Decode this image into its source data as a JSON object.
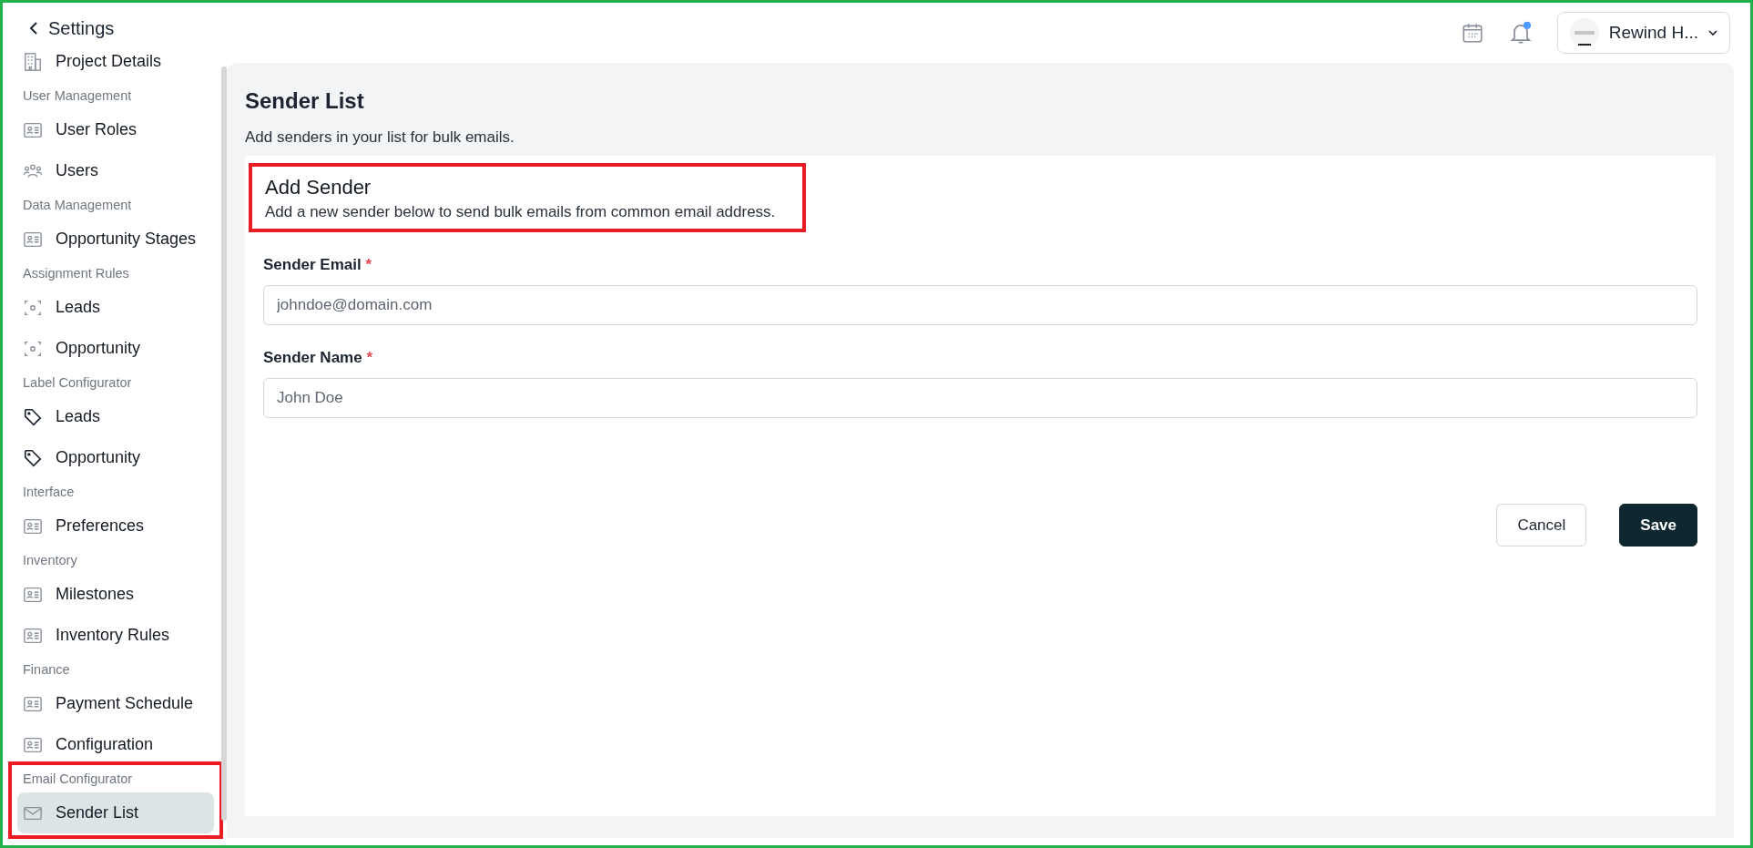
{
  "back": {
    "label": "Settings"
  },
  "sidebar": {
    "items": [
      {
        "label": "Project Details",
        "kind": "building",
        "selected": false
      }
    ],
    "groups": [
      {
        "title": "User Management",
        "highlighted": false,
        "items": [
          {
            "label": "User Roles",
            "kind": "card",
            "selected": false
          },
          {
            "label": "Users",
            "kind": "people",
            "selected": false
          }
        ]
      },
      {
        "title": "Data Management",
        "highlighted": false,
        "items": [
          {
            "label": "Opportunity Stages",
            "kind": "card",
            "selected": false
          }
        ]
      },
      {
        "title": "Assignment Rules",
        "highlighted": false,
        "items": [
          {
            "label": "Leads",
            "kind": "focus",
            "selected": false
          },
          {
            "label": "Opportunity",
            "kind": "focus",
            "selected": false
          }
        ]
      },
      {
        "title": "Label Configurator",
        "highlighted": false,
        "items": [
          {
            "label": "Leads",
            "kind": "tag",
            "selected": false
          },
          {
            "label": "Opportunity",
            "kind": "tag",
            "selected": false
          }
        ]
      },
      {
        "title": "Interface",
        "highlighted": false,
        "items": [
          {
            "label": "Preferences",
            "kind": "card",
            "selected": false
          }
        ]
      },
      {
        "title": "Inventory",
        "highlighted": false,
        "items": [
          {
            "label": "Milestones",
            "kind": "card",
            "selected": false
          },
          {
            "label": "Inventory Rules",
            "kind": "card",
            "selected": false
          }
        ]
      },
      {
        "title": "Finance",
        "highlighted": false,
        "items": [
          {
            "label": "Payment Schedule",
            "kind": "card",
            "selected": false
          },
          {
            "label": "Configuration",
            "kind": "card",
            "selected": false
          }
        ]
      },
      {
        "title": "Email Configurator",
        "highlighted": true,
        "items": [
          {
            "label": "Sender List",
            "kind": "mail",
            "selected": true
          }
        ]
      }
    ]
  },
  "header": {
    "notification_unread": true,
    "account": {
      "label": "Rewind H..."
    }
  },
  "page": {
    "title": "Sender List",
    "subtitle": "Add senders in your list for bulk emails."
  },
  "form": {
    "title": "Add Sender",
    "description": "Add a new sender below to send bulk emails from common email address.",
    "highlighted": true,
    "fields": [
      {
        "label": "Sender Email",
        "required_mark": "*",
        "placeholder": "johndoe@domain.com"
      },
      {
        "label": "Sender Name",
        "required_mark": "*",
        "placeholder": "John Doe"
      }
    ],
    "buttons": [
      {
        "label": "Cancel",
        "kind": "secondary"
      },
      {
        "label": "Save",
        "kind": "primary"
      }
    ]
  }
}
